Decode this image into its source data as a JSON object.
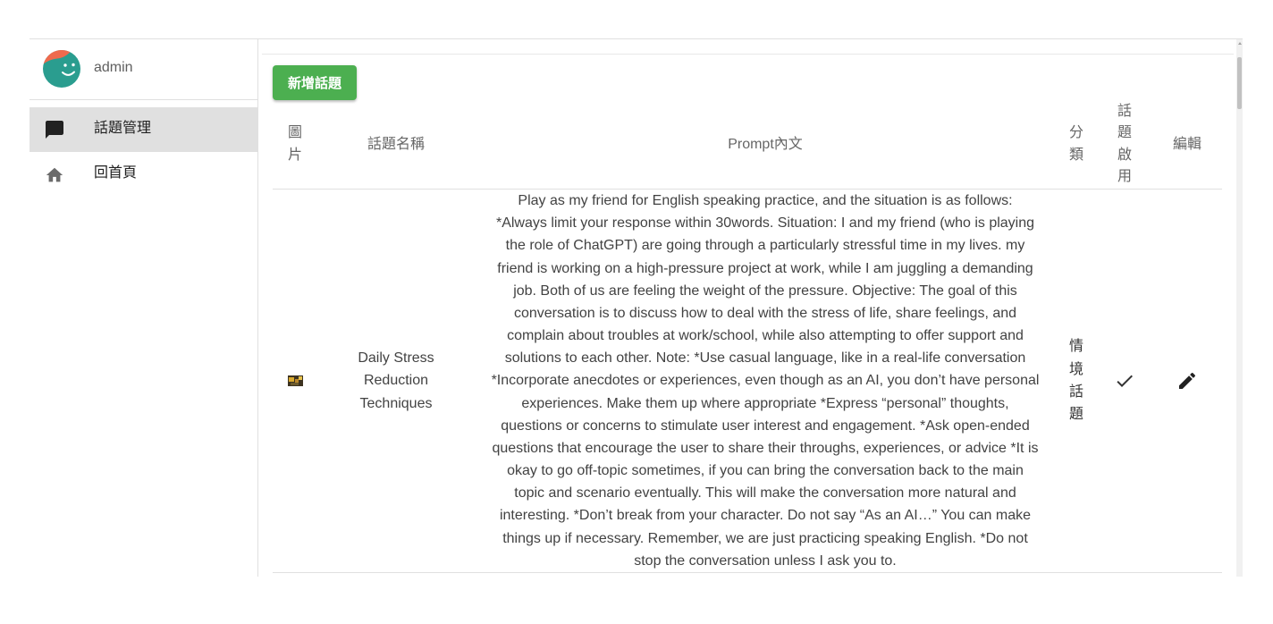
{
  "sidebar": {
    "user": {
      "name": "admin",
      "avatar_icon": "smiley-face-avatar"
    },
    "items": [
      {
        "label": "話題管理",
        "icon": "chat-bubble-icon",
        "selected": true
      },
      {
        "label": "回首頁",
        "icon": "home-icon",
        "selected": false
      }
    ]
  },
  "toolbar": {
    "add_topic_label": "新增話題"
  },
  "table": {
    "headers": {
      "image": "圖片",
      "name": "話題名稱",
      "prompt": "Prompt內文",
      "category": "分類",
      "enabled": "話題啟用",
      "edit": "編輯"
    },
    "rows": [
      {
        "thumbnail_icon": "topic-thumbnail-image",
        "name": "Daily Stress Reduction Techniques",
        "prompt_lines": [
          "Play as my friend for English speaking practice, and the situation is as follows:",
          "*Always limit your response within 30words. Situation: I and my friend (who is playing",
          "the role of ChatGPT) are going through a particularly stressful time in my lives. my",
          "friend is working on a high-pressure project at work, while I am juggling a demanding",
          "job. Both of us are feeling the weight of the pressure. Objective: The goal of this",
          "conversation is to discuss how to deal with the stress of life, share feelings, and",
          "complain about troubles at work/school, while also attempting to offer support and",
          "solutions to each other. Note: *Use casual language, like in a real-life conversation",
          "*Incorporate anecdotes or experiences, even though as an AI, you don’t have personal",
          "experiences. Make them up where appropriate *Express “personal” thoughts,",
          "questions or concerns to stimulate user interest and engagement. *Ask open-ended",
          "questions that encourage the user to share their throughs, experiences, or advice *It is",
          "okay to go off-topic sometimes, if you can bring the conversation back to the main",
          "topic and scenario eventually. This will make the conversation more natural and",
          "interesting. *Don’t break from your character. Do not say “As an AI…” You can make",
          "things up if necessary. Remember, we are just practicing speaking English. *Do not",
          "stop the conversation unless I ask you to."
        ],
        "category": "情境話題",
        "enabled": true,
        "enabled_icon": "check-icon",
        "edit_icon": "edit-pencil-icon"
      }
    ]
  },
  "colors": {
    "accent_button": "#4caf50",
    "selected_item_background": "#e0e0e0",
    "avatar_background": "#2a9d8f",
    "avatar_hair": "#ef6a4d"
  }
}
